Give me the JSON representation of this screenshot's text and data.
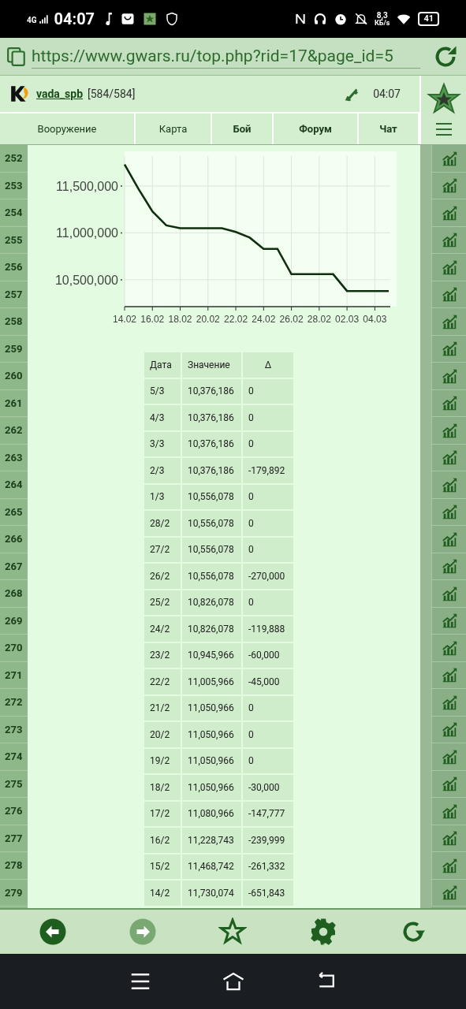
{
  "status_bar": {
    "network": "4G",
    "time": "04:07",
    "speed": "8,3",
    "speed_unit": "КБ/s",
    "battery": "41"
  },
  "browser": {
    "url": "https://www.gwars.ru/top.php?rid=17&page_id=5"
  },
  "header": {
    "username": "vada_spb",
    "hp": "[584/584]",
    "time": "04:07"
  },
  "nav_tabs": [
    {
      "label": "Вооружение",
      "bold": false
    },
    {
      "label": "Карта",
      "bold": false
    },
    {
      "label": "Бой",
      "bold": true
    },
    {
      "label": "Форум",
      "bold": true
    },
    {
      "label": "Чат",
      "bold": true
    }
  ],
  "ranks": [
    "252",
    "253",
    "254",
    "255",
    "256",
    "257",
    "258",
    "259",
    "260",
    "261",
    "262",
    "263",
    "264",
    "265",
    "266",
    "267",
    "268",
    "269",
    "270",
    "271",
    "272",
    "273",
    "274",
    "275",
    "276",
    "277",
    "278",
    "279"
  ],
  "chart_data": {
    "type": "line",
    "grid": true,
    "categories": [
      "14.02",
      null,
      "16.02",
      null,
      "18.02",
      null,
      "20.02",
      null,
      "22.02",
      null,
      "24.02",
      null,
      "26.02",
      null,
      "28.02",
      null,
      "02.03",
      null,
      "04.03",
      null
    ],
    "series": [
      {
        "color": "#0f2e0f",
        "values": [
          11730000,
          11470000,
          11230000,
          11080000,
          11050000,
          11050000,
          11050000,
          11050000,
          11010000,
          10950000,
          10830000,
          10830000,
          10560000,
          10560000,
          10560000,
          10560000,
          10380000,
          10380000,
          10380000,
          10380000
        ]
      }
    ],
    "ylim": [
      10230000,
      11870000
    ],
    "yticks": [
      {
        "value": 10500000,
        "label": "10,500,000"
      },
      {
        "value": 11000000,
        "label": "11,000,000"
      },
      {
        "value": 11500000,
        "label": "11,500,000"
      }
    ]
  },
  "table": {
    "columns": [
      "Дата",
      "Значение",
      "Δ"
    ],
    "rows": [
      [
        "5/3",
        "10,376,186",
        "0"
      ],
      [
        "4/3",
        "10,376,186",
        "0"
      ],
      [
        "3/3",
        "10,376,186",
        "0"
      ],
      [
        "2/3",
        "10,376,186",
        "-179,892"
      ],
      [
        "1/3",
        "10,556,078",
        "0"
      ],
      [
        "28/2",
        "10,556,078",
        "0"
      ],
      [
        "27/2",
        "10,556,078",
        "0"
      ],
      [
        "26/2",
        "10,556,078",
        "-270,000"
      ],
      [
        "25/2",
        "10,826,078",
        "0"
      ],
      [
        "24/2",
        "10,826,078",
        "-119,888"
      ],
      [
        "23/2",
        "10,945,966",
        "-60,000"
      ],
      [
        "22/2",
        "11,005,966",
        "-45,000"
      ],
      [
        "21/2",
        "11,050,966",
        "0"
      ],
      [
        "20/2",
        "11,050,966",
        "0"
      ],
      [
        "19/2",
        "11,050,966",
        "0"
      ],
      [
        "18/2",
        "11,050,966",
        "-30,000"
      ],
      [
        "17/2",
        "11,080,966",
        "-147,777"
      ],
      [
        "16/2",
        "11,228,743",
        "-239,999"
      ],
      [
        "15/2",
        "11,468,742",
        "-261,332"
      ],
      [
        "14/2",
        "11,730,074",
        "-651,843"
      ]
    ]
  },
  "toolbar": [
    {
      "kind": "back",
      "disabled": false
    },
    {
      "kind": "forward",
      "disabled": true
    },
    {
      "kind": "star",
      "disabled": false
    },
    {
      "kind": "settings",
      "disabled": false
    },
    {
      "kind": "reload",
      "disabled": false
    }
  ]
}
